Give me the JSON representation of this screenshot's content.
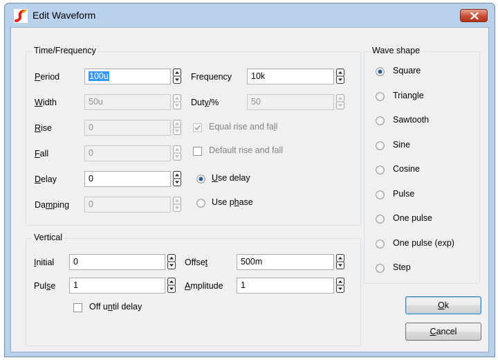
{
  "window": {
    "title": "Edit Waveform"
  },
  "time_frequency": {
    "title": "Time/Frequency",
    "period": {
      "pre": "",
      "acc": "P",
      "post": "eriod",
      "value": "100u"
    },
    "width": {
      "pre": "",
      "acc": "W",
      "post": "idth",
      "value": "50u"
    },
    "rise": {
      "pre": "",
      "acc": "R",
      "post": "ise",
      "value": "0"
    },
    "fall": {
      "pre": "",
      "acc": "F",
      "post": "all",
      "value": "0"
    },
    "delay": {
      "pre": "",
      "acc": "D",
      "post": "elay",
      "value": "0"
    },
    "damping": {
      "pre": "Da",
      "acc": "m",
      "post": "ping",
      "value": "0"
    },
    "frequency": {
      "pre": "Frequency",
      "acc": "",
      "post": "",
      "value": "10k"
    },
    "duty": {
      "pre": "Dut",
      "acc": "y",
      "post": "/%",
      "value": "50"
    },
    "equal_rise_fall": {
      "pre": "Equal rise and fa",
      "acc": "l",
      "post": "l",
      "checked": true
    },
    "default_rise_fall": {
      "label": "Default rise and fall",
      "checked": false
    },
    "use_delay": {
      "pre": "",
      "acc": "U",
      "post": "se delay",
      "selected": true
    },
    "use_phase": {
      "pre": "Use p",
      "acc": "h",
      "post": "ase",
      "selected": false
    }
  },
  "vertical": {
    "title": "Vertical",
    "initial": {
      "pre": "",
      "acc": "I",
      "post": "nitial",
      "value": "0"
    },
    "pulse": {
      "pre": "Pul",
      "acc": "s",
      "post": "e",
      "value": "1"
    },
    "offset": {
      "pre": "Offse",
      "acc": "t",
      "post": "",
      "value": "500m"
    },
    "amplitude": {
      "pre": "",
      "acc": "A",
      "post": "mplitude",
      "value": "1"
    },
    "off_until_delay": {
      "pre": "Off u",
      "acc": "n",
      "post": "til delay",
      "checked": false
    }
  },
  "wave_shape": {
    "title": "Wave shape",
    "options": [
      {
        "label": "Square",
        "selected": true
      },
      {
        "label": "Triangle",
        "selected": false
      },
      {
        "label": "Sawtooth",
        "selected": false
      },
      {
        "label": "Sine",
        "selected": false
      },
      {
        "label": "Cosine",
        "selected": false
      },
      {
        "label": "Pulse",
        "selected": false
      },
      {
        "label": "One pulse",
        "selected": false
      },
      {
        "label": "One pulse (exp)",
        "selected": false
      },
      {
        "label": "Step",
        "selected": false
      }
    ]
  },
  "buttons": {
    "ok": {
      "pre": "",
      "acc": "O",
      "post": "k"
    },
    "cancel": {
      "pre": "",
      "acc": "C",
      "post": "ancel"
    }
  },
  "colors": {
    "frame": "#b9d1ea",
    "dialog_bg": "#f0f0f0",
    "selection": "#3399ff",
    "close_button": "#c84d34"
  },
  "icons": {
    "app": "simetrix-logo-icon",
    "close": "close-icon"
  }
}
